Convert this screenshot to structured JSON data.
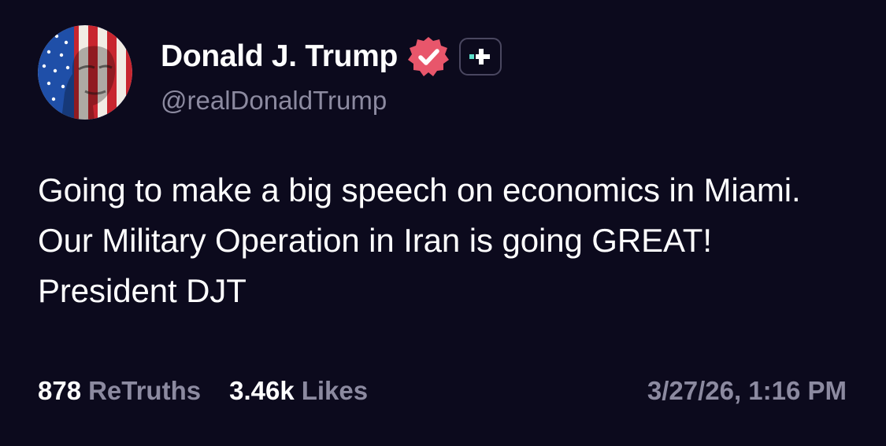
{
  "post": {
    "author": {
      "display_name": "Donald J. Trump",
      "handle": "@realDonaldTrump",
      "verified_icon": "verified-badge-icon",
      "plus_icon": "truth-plus-icon"
    },
    "text": "Going to make a big speech on economics in Miami. Our Military Operation in Iran is going GREAT! President DJT",
    "stats": {
      "retruths_count": "878",
      "retruths_label": "ReTruths",
      "likes_count": "3.46k",
      "likes_label": "Likes"
    },
    "timestamp": "3/27/26, 1:16 PM"
  },
  "colors": {
    "background": "#0c0a1d",
    "text": "#ffffff",
    "muted": "#8c8aa0",
    "verified_badge": "#e8566b",
    "plus_accent": "#5ee0cc"
  }
}
